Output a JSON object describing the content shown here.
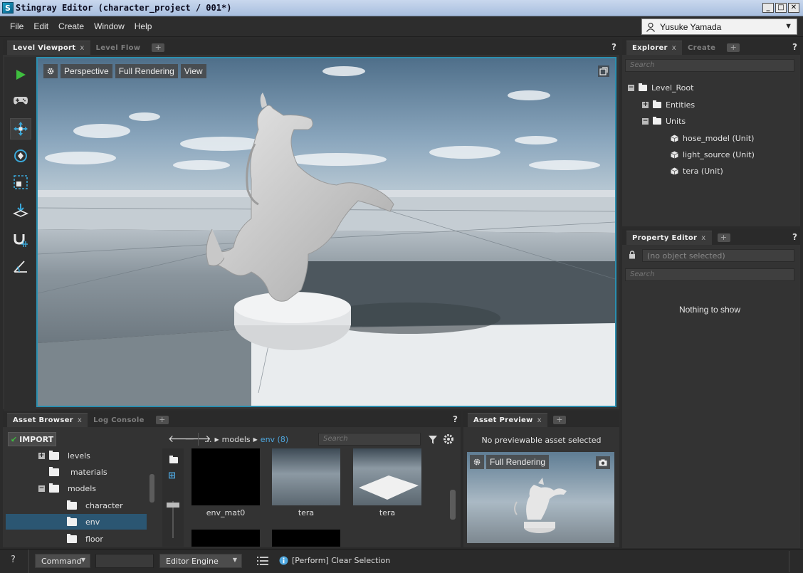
{
  "window": {
    "title": "Stingray Editor (character_project / 001*)",
    "app_icon": "S"
  },
  "menu": [
    "File",
    "Edit",
    "Create",
    "Window",
    "Help"
  ],
  "user": {
    "name": "Yusuke Yamada"
  },
  "viewport_panel": {
    "tabs": [
      "Level Viewport",
      "Level Flow"
    ],
    "toolbar": [
      "Perspective",
      "Full Rendering",
      "View"
    ]
  },
  "explorer": {
    "tabs": [
      "Explorer",
      "Create"
    ],
    "search_placeholder": "Search",
    "tree": {
      "root": "Level_Root",
      "entities": "Entities",
      "units": "Units",
      "items": [
        "hose_model (Unit)",
        "light_source (Unit)",
        "tera (Unit)"
      ]
    }
  },
  "property_editor": {
    "tab": "Property Editor",
    "selection": "(no object selected)",
    "search_placeholder": "Search",
    "empty": "Nothing to show"
  },
  "asset_browser": {
    "tabs": [
      "Asset Browser",
      "Log Console"
    ],
    "import_label": "IMPORT",
    "breadcrumb": {
      "prefix": "...",
      "models": "models",
      "current": "env (8)"
    },
    "search_placeholder": "Search",
    "folders": [
      "levels",
      "materials",
      "models",
      "character",
      "env",
      "floor"
    ],
    "assets": [
      "env_mat0",
      "tera",
      "tera"
    ]
  },
  "asset_preview": {
    "tab": "Asset Preview",
    "message": "No previewable asset selected",
    "mode": "Full Rendering"
  },
  "statusbar": {
    "help": "?",
    "command": "Command",
    "engine": "Editor Engine",
    "message": "[Perform] Clear Selection"
  },
  "colors": {
    "accent": "#2b8fb0",
    "play": "#3fbf3f",
    "breadcrumb_active": "#4fa8e0"
  }
}
